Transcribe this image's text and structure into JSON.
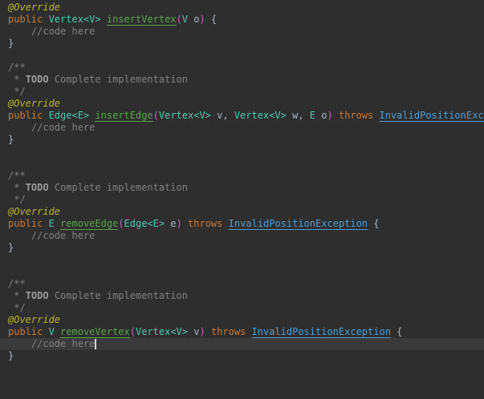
{
  "app": {
    "kind": "code-editor",
    "language": "java"
  },
  "editor": {
    "background": "#2e2e2e",
    "current_line_background": "#3a3a3a",
    "colors": {
      "kw": "#cc7832",
      "ann": "#bbb529",
      "com": "#808080",
      "todo": "#9d9d9d",
      "typ": "#4ec9b0",
      "mth": "#57a64a",
      "exc": "#4f9fd8",
      "par": "#d05ec7",
      "def": "#a9b7c6",
      "squiggle": "#e8387e",
      "cursor": "#d4d4d4"
    },
    "lines": [
      {
        "tokens": [
          {
            "t": "@Override",
            "c": "ann"
          }
        ]
      },
      {
        "tokens": [
          {
            "t": "public ",
            "c": "kw"
          },
          {
            "t": "Vertex<V>",
            "c": "typ"
          },
          {
            "t": " ",
            "c": "def"
          },
          {
            "t": "insertVertex",
            "c": "mth",
            "u": true,
            "q": true
          },
          {
            "t": "(",
            "c": "par",
            "q": true
          },
          {
            "t": "V",
            "c": "typ",
            "q": true
          },
          {
            "t": " o",
            "c": "def",
            "q": true
          },
          {
            "t": ")",
            "c": "par",
            "q": true
          },
          {
            "t": " {",
            "c": "def"
          }
        ]
      },
      {
        "tokens": [
          {
            "t": "    //code here",
            "c": "com"
          }
        ]
      },
      {
        "tokens": [
          {
            "t": "}",
            "c": "def"
          }
        ]
      },
      {
        "tokens": []
      },
      {
        "tokens": [
          {
            "t": "/**",
            "c": "com"
          }
        ]
      },
      {
        "tokens": [
          {
            "t": " * ",
            "c": "com"
          },
          {
            "t": "TODO",
            "c": "todo"
          },
          {
            "t": " Complete implementation",
            "c": "com"
          }
        ]
      },
      {
        "tokens": [
          {
            "t": " */",
            "c": "com"
          }
        ]
      },
      {
        "tokens": [
          {
            "t": "@Override",
            "c": "ann"
          }
        ]
      },
      {
        "tokens": [
          {
            "t": "public ",
            "c": "kw"
          },
          {
            "t": "Edge<E>",
            "c": "typ"
          },
          {
            "t": " ",
            "c": "def"
          },
          {
            "t": "insertEdge",
            "c": "mth",
            "u": true,
            "q": true
          },
          {
            "t": "(",
            "c": "par",
            "q": true
          },
          {
            "t": "Vertex<V>",
            "c": "typ",
            "q": true
          },
          {
            "t": " v, ",
            "c": "def",
            "q": true
          },
          {
            "t": "Vertex<V>",
            "c": "typ",
            "q": true
          },
          {
            "t": " w, ",
            "c": "def",
            "q": true
          },
          {
            "t": "E",
            "c": "typ",
            "q": true
          },
          {
            "t": " o",
            "c": "def",
            "q": true
          },
          {
            "t": ")",
            "c": "par",
            "q": true
          },
          {
            "t": " ",
            "c": "def",
            "q": true
          },
          {
            "t": "throws",
            "c": "kw",
            "q": true
          },
          {
            "t": " ",
            "c": "def",
            "q": true
          },
          {
            "t": "InvalidPositionExcep",
            "c": "exc",
            "u": true,
            "q": true
          }
        ]
      },
      {
        "tokens": [
          {
            "t": "    //code here",
            "c": "com"
          }
        ]
      },
      {
        "tokens": [
          {
            "t": "}",
            "c": "def"
          }
        ]
      },
      {
        "tokens": []
      },
      {
        "tokens": []
      },
      {
        "tokens": [
          {
            "t": "/**",
            "c": "com"
          }
        ]
      },
      {
        "tokens": [
          {
            "t": " * ",
            "c": "com"
          },
          {
            "t": "TODO",
            "c": "todo"
          },
          {
            "t": " Complete implementation",
            "c": "com"
          }
        ]
      },
      {
        "tokens": [
          {
            "t": " */",
            "c": "com"
          }
        ]
      },
      {
        "tokens": [
          {
            "t": "@Override",
            "c": "ann"
          }
        ]
      },
      {
        "tokens": [
          {
            "t": "public ",
            "c": "kw"
          },
          {
            "t": "E",
            "c": "typ"
          },
          {
            "t": " ",
            "c": "def"
          },
          {
            "t": "removeEdge",
            "c": "mth",
            "u": true,
            "q": true
          },
          {
            "t": "(",
            "c": "par",
            "q": true
          },
          {
            "t": "Edge<E>",
            "c": "typ",
            "q": true
          },
          {
            "t": " e",
            "c": "def",
            "q": true
          },
          {
            "t": ")",
            "c": "par",
            "q": true
          },
          {
            "t": " ",
            "c": "def",
            "q": true
          },
          {
            "t": "throws",
            "c": "kw",
            "q": true
          },
          {
            "t": " ",
            "c": "def",
            "q": true
          },
          {
            "t": "InvalidPositionException",
            "c": "exc",
            "u": true,
            "q": true
          },
          {
            "t": " {",
            "c": "def"
          }
        ]
      },
      {
        "tokens": [
          {
            "t": "    //code here",
            "c": "com"
          }
        ]
      },
      {
        "tokens": [
          {
            "t": "}",
            "c": "def"
          }
        ]
      },
      {
        "tokens": []
      },
      {
        "tokens": []
      },
      {
        "tokens": [
          {
            "t": "/**",
            "c": "com"
          }
        ]
      },
      {
        "tokens": [
          {
            "t": " * ",
            "c": "com"
          },
          {
            "t": "TODO",
            "c": "todo"
          },
          {
            "t": " Complete implementation",
            "c": "com"
          }
        ]
      },
      {
        "tokens": [
          {
            "t": " */",
            "c": "com"
          }
        ]
      },
      {
        "tokens": [
          {
            "t": "@Override",
            "c": "ann"
          }
        ]
      },
      {
        "tokens": [
          {
            "t": "public ",
            "c": "kw"
          },
          {
            "t": "V",
            "c": "typ"
          },
          {
            "t": " ",
            "c": "def"
          },
          {
            "t": "removeVertex",
            "c": "mth",
            "u": true,
            "q": true
          },
          {
            "t": "(",
            "c": "par",
            "q": true
          },
          {
            "t": "Vertex<V>",
            "c": "typ",
            "q": true
          },
          {
            "t": " v",
            "c": "def",
            "q": true
          },
          {
            "t": ")",
            "c": "par",
            "q": true
          },
          {
            "t": " ",
            "c": "def",
            "q": true
          },
          {
            "t": "throws",
            "c": "kw",
            "q": true
          },
          {
            "t": " ",
            "c": "def",
            "q": true
          },
          {
            "t": "InvalidPositionException",
            "c": "exc",
            "u": true,
            "q": true
          },
          {
            "t": " {",
            "c": "def"
          }
        ]
      },
      {
        "tokens": [
          {
            "t": "    //code here",
            "c": "com"
          }
        ],
        "current": true,
        "cursor": true
      },
      {
        "tokens": [
          {
            "t": "}",
            "c": "def"
          }
        ]
      }
    ]
  }
}
